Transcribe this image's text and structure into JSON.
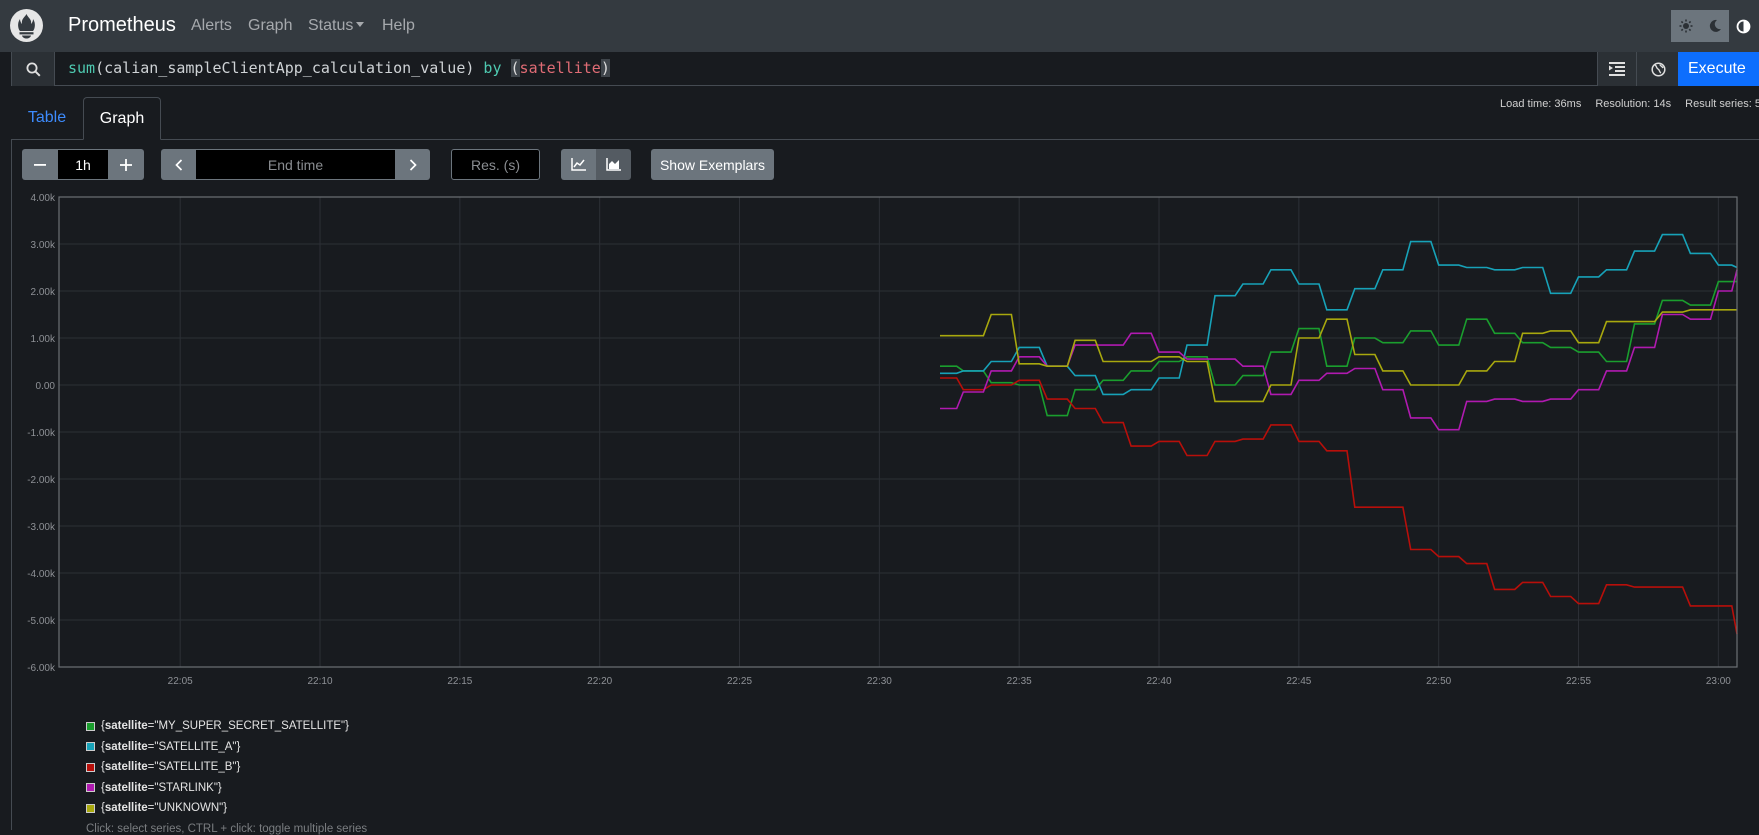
{
  "navbar": {
    "brand": "Prometheus",
    "links": {
      "alerts": "Alerts",
      "graph": "Graph",
      "status": "Status",
      "help": "Help"
    },
    "theme_icons": [
      "sun-icon",
      "moon-icon",
      "contrast-icon"
    ]
  },
  "query": {
    "fn": "sum",
    "open_paren": "(",
    "metric": "calian_sampleClientApp_calculation_value",
    "close_paren": ")",
    "keyword": "by",
    "grp_open": "(",
    "label": "satellite",
    "grp_close": ")",
    "execute_label": "Execute"
  },
  "tabs": {
    "table": "Table",
    "graph": "Graph"
  },
  "stats": {
    "load_time": "Load time: 36ms",
    "resolution": "Resolution: 14s",
    "result_series": "Result series: 5"
  },
  "controls": {
    "range_value": "1h",
    "end_time_placeholder": "End time",
    "res_placeholder": "Res. (s)",
    "exemplars_label": "Show Exemplars"
  },
  "legend": {
    "label_key": "satellite",
    "hint": "Click: select series, CTRL + click: toggle multiple series"
  },
  "chart_data": {
    "type": "line",
    "y_ticks": [
      "4.00k",
      "3.00k",
      "2.00k",
      "1.00k",
      "0.00",
      "-1.00k",
      "-2.00k",
      "-3.00k",
      "-4.00k",
      "-5.00k",
      "-6.00k"
    ],
    "ylim": [
      -6000,
      4000
    ],
    "x_ticks": [
      "22:05",
      "22:10",
      "22:15",
      "22:20",
      "22:25",
      "22:30",
      "22:35",
      "22:40",
      "22:45",
      "22:50",
      "22:55",
      "23:00"
    ],
    "xlim": [
      "22:00:40",
      "23:00:40"
    ],
    "grid": true,
    "legend_position": "bottom",
    "series": [
      {
        "name": "MY_SUPER_SECRET_SATELLITE",
        "color": "#1a9e2e",
        "x": [
          "22:32:10",
          "22:33:00",
          "22:34:00",
          "22:35:00",
          "22:36:00",
          "22:37:00",
          "22:38:00",
          "22:39:00",
          "22:40:00",
          "22:41:00",
          "22:42:00",
          "22:43:00",
          "22:44:00",
          "22:45:00",
          "22:46:00",
          "22:47:00",
          "22:48:00",
          "22:49:00",
          "22:50:00",
          "22:51:00",
          "22:52:00",
          "22:53:00",
          "22:54:00",
          "22:55:00",
          "22:56:00",
          "22:57:00",
          "22:58:00",
          "22:59:00",
          "23:00:00",
          "23:00:40"
        ],
        "y": [
          400,
          300,
          50,
          0,
          -650,
          -100,
          100,
          300,
          500,
          600,
          0,
          200,
          700,
          1200,
          400,
          1000,
          900,
          1150,
          850,
          1400,
          1100,
          900,
          800,
          700,
          500,
          1300,
          1800,
          1700,
          2200,
          2200
        ]
      },
      {
        "name": "SATELLITE_A",
        "color": "#17a2b8",
        "x": [
          "22:32:10",
          "22:33:00",
          "22:34:00",
          "22:35:00",
          "22:36:00",
          "22:37:00",
          "22:38:00",
          "22:39:00",
          "22:40:00",
          "22:41:00",
          "22:42:00",
          "22:43:00",
          "22:44:00",
          "22:45:00",
          "22:46:00",
          "22:47:00",
          "22:48:00",
          "22:49:00",
          "22:50:00",
          "22:51:00",
          "22:52:00",
          "22:53:00",
          "22:54:00",
          "22:55:00",
          "22:56:00",
          "22:57:00",
          "22:58:00",
          "22:59:00",
          "23:00:00",
          "23:00:40"
        ],
        "y": [
          250,
          300,
          500,
          800,
          400,
          200,
          -200,
          -100,
          150,
          850,
          1900,
          2150,
          2450,
          2150,
          1600,
          2050,
          2450,
          3050,
          2550,
          2500,
          2450,
          2500,
          1950,
          2300,
          2450,
          2850,
          3200,
          2800,
          2550,
          2500
        ]
      },
      {
        "name": "SATELLITE_B",
        "color": "#b80f0a",
        "x": [
          "22:32:10",
          "22:33:00",
          "22:34:00",
          "22:35:00",
          "22:36:00",
          "22:37:00",
          "22:38:00",
          "22:39:00",
          "22:40:00",
          "22:41:00",
          "22:42:00",
          "22:43:00",
          "22:44:00",
          "22:45:00",
          "22:46:00",
          "22:47:00",
          "22:48:00",
          "22:49:00",
          "22:50:00",
          "22:51:00",
          "22:52:00",
          "22:53:00",
          "22:54:00",
          "22:55:00",
          "22:56:00",
          "22:57:00",
          "22:58:00",
          "22:59:00",
          "23:00:00",
          "23:00:40"
        ],
        "y": [
          150,
          -100,
          0,
          100,
          -300,
          -500,
          -800,
          -1300,
          -1200,
          -1500,
          -1200,
          -1150,
          -850,
          -1200,
          -1400,
          -2600,
          -2600,
          -3500,
          -3650,
          -3800,
          -4350,
          -4200,
          -4500,
          -4650,
          -4250,
          -4300,
          -4300,
          -4700,
          -4700,
          -5300
        ]
      },
      {
        "name": "STARLINK",
        "color": "#b01ab0",
        "x": [
          "22:32:10",
          "22:33:00",
          "22:34:00",
          "22:35:00",
          "22:36:00",
          "22:37:00",
          "22:38:00",
          "22:39:00",
          "22:40:00",
          "22:41:00",
          "22:42:00",
          "22:43:00",
          "22:44:00",
          "22:45:00",
          "22:46:00",
          "22:47:00",
          "22:48:00",
          "22:49:00",
          "22:50:00",
          "22:51:00",
          "22:52:00",
          "22:53:00",
          "22:54:00",
          "22:55:00",
          "22:56:00",
          "22:57:00",
          "22:58:00",
          "22:59:00",
          "23:00:00",
          "23:00:40"
        ],
        "y": [
          -500,
          -150,
          300,
          600,
          400,
          850,
          850,
          1100,
          700,
          550,
          550,
          400,
          -200,
          100,
          250,
          350,
          -100,
          -700,
          -950,
          -350,
          -300,
          -350,
          -300,
          -100,
          300,
          800,
          1500,
          1400,
          2000,
          2450
        ]
      },
      {
        "name": "UNKNOWN",
        "color": "#a8a80e",
        "x": [
          "22:32:10",
          "22:33:00",
          "22:34:00",
          "22:35:00",
          "22:36:00",
          "22:37:00",
          "22:38:00",
          "22:39:00",
          "22:40:00",
          "22:41:00",
          "22:42:00",
          "22:43:00",
          "22:44:00",
          "22:45:00",
          "22:46:00",
          "22:47:00",
          "22:48:00",
          "22:49:00",
          "22:50:00",
          "22:51:00",
          "22:52:00",
          "22:53:00",
          "22:54:00",
          "22:55:00",
          "22:56:00",
          "22:57:00",
          "22:58:00",
          "22:59:00",
          "23:00:00",
          "23:00:40"
        ],
        "y": [
          1050,
          1050,
          1500,
          450,
          400,
          950,
          500,
          500,
          600,
          500,
          -350,
          -350,
          0,
          1000,
          1400,
          650,
          300,
          0,
          0,
          300,
          500,
          1100,
          1150,
          900,
          1350,
          1350,
          1550,
          1600,
          1600,
          1600
        ]
      }
    ]
  }
}
